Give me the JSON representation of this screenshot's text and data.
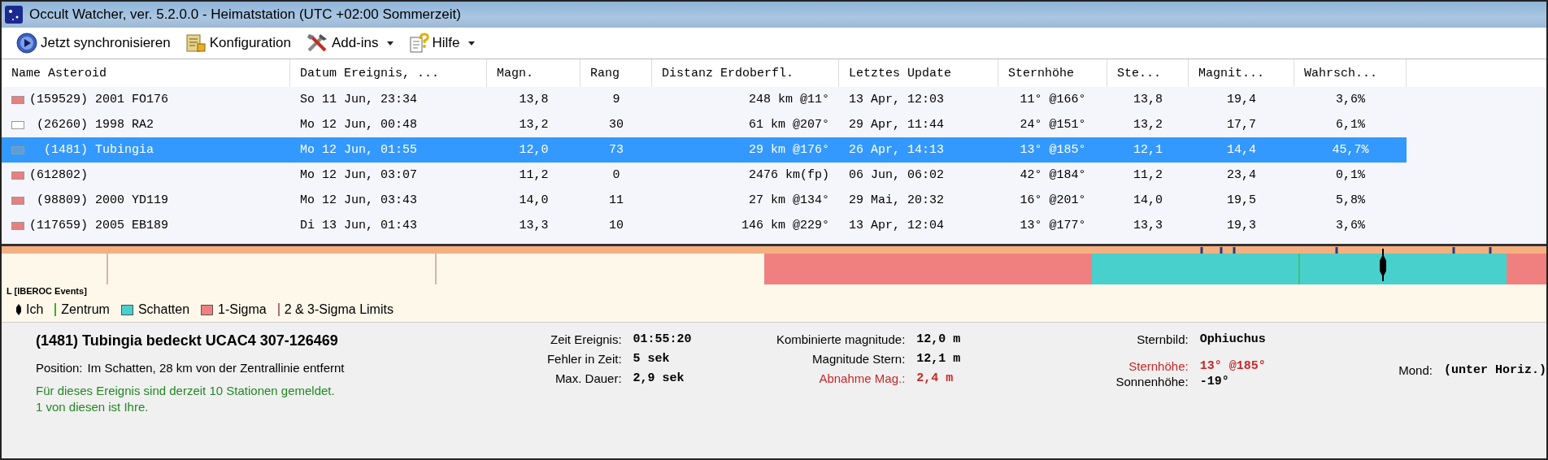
{
  "window": {
    "title": "Occult Watcher, ver. 5.2.0.0 - Heimatstation (UTC +02:00 Sommerzeit)"
  },
  "toolbar": [
    {
      "label": "Jetzt synchronisieren",
      "kind": "sync",
      "dropdown": false
    },
    {
      "label": "Konfiguration",
      "kind": "config",
      "dropdown": false
    },
    {
      "label": "Add-ins",
      "kind": "tools",
      "dropdown": true
    },
    {
      "label": "Hilfe",
      "kind": "help",
      "dropdown": true
    }
  ],
  "table": {
    "columns": [
      "Name Asteroid",
      "Datum Ereignis, ...",
      "Magn.",
      "Rang",
      "Distanz Erdoberfl.",
      "Letztes Update",
      "Sternhöhe",
      "Ste...",
      "Magnit...",
      "Wahrsch..."
    ],
    "rows": [
      {
        "selected": false,
        "color": "#e88080",
        "cells": [
          "(159529) 2001 FO176",
          "So 11 Jun, 23:34",
          "13,8",
          "9",
          "248 km @11°",
          "13 Apr, 12:03",
          "11° @166°",
          "13,8",
          "19,4",
          "3,6%"
        ]
      },
      {
        "selected": false,
        "color": "#ffffff",
        "cells": [
          " (26260) 1998 RA2",
          "Mo 12 Jun, 00:48",
          "13,2",
          "30",
          "61 km @207°",
          "29 Apr, 11:44",
          "24° @151°",
          "13,2",
          "17,7",
          "6,1%"
        ]
      },
      {
        "selected": true,
        "color": "#5aa0d8",
        "cells": [
          "  (1481) Tubingia",
          "Mo 12 Jun, 01:55",
          "12,0",
          "73",
          "29 km @176°",
          "26 Apr, 14:13",
          "13° @185°",
          "12,1",
          "14,4",
          "45,7%"
        ]
      },
      {
        "selected": false,
        "color": "#e88080",
        "cells": [
          "(612802)",
          "Mo 12 Jun, 03:07",
          "11,2",
          "0",
          "2476 km(fp)",
          "06 Jun, 06:02",
          "42° @184°",
          "11,2",
          "23,4",
          "0,1%"
        ]
      },
      {
        "selected": false,
        "color": "#e88080",
        "cells": [
          " (98809) 2000 YD119",
          "Mo 12 Jun, 03:43",
          "14,0",
          "11",
          "27 km @134°",
          "29 Mai, 20:32",
          "16° @201°",
          "14,0",
          "19,5",
          "5,8%"
        ]
      },
      {
        "selected": false,
        "color": "#e88080",
        "cells": [
          "(117659) 2005 EB189",
          "Di 13 Jun, 01:43",
          "13,3",
          "10",
          "146 km @229°",
          "13 Apr, 12:04",
          "13° @177°",
          "13,3",
          "19,3",
          "3,6%"
        ]
      }
    ]
  },
  "strip": {
    "label": "L [IBEROC Events]"
  },
  "legend": [
    {
      "kind": "marker",
      "label": "Ich",
      "color": "#000000"
    },
    {
      "kind": "line",
      "label": "Zentrum",
      "color": "#40b020"
    },
    {
      "kind": "box",
      "label": "Schatten",
      "color": "#48d0cc"
    },
    {
      "kind": "box",
      "label": "1-Sigma",
      "color": "#f08080"
    },
    {
      "kind": "line",
      "label": "2 & 3-Sigma Limits",
      "color": "#b07070"
    }
  ],
  "details": {
    "title": "(1481) Tubingia bedeckt UCAC4 307-126469",
    "position_label": "Position:",
    "position": "Im Schatten, 28 km von der Zentrallinie entfernt",
    "note": [
      "Für dieses Ereignis sind derzeit 10 Stationen gemeldet.",
      "1 von diesen ist Ihre."
    ],
    "columns": [
      [
        {
          "label": "Zeit Ereignis:",
          "value": "01:55:20",
          "alert": false
        },
        {
          "label": "Fehler in Zeit:",
          "value": "5 sek",
          "alert": false
        },
        {
          "label": "Max. Dauer:",
          "value": "2,9 sek",
          "alert": false
        }
      ],
      [
        {
          "label": "Kombinierte magnitude:",
          "value": "12,0 m",
          "alert": false
        },
        {
          "label": "Magnitude Stern:",
          "value": "12,1 m",
          "alert": false
        },
        {
          "label": "Abnahme Mag.:",
          "value": "2,4 m",
          "alert": true
        }
      ],
      [
        {
          "label": "Sternbild:",
          "value": "Ophiuchus",
          "alert": false
        },
        {
          "label": "Sternhöhe:",
          "value": "13° @185°",
          "alert": true
        },
        {
          "label": "Sonnenhöhe:",
          "value": "-19°",
          "alert": false
        }
      ],
      [
        {
          "label": "Mond:",
          "value": "(unter Horiz.)",
          "alert": false
        }
      ]
    ]
  }
}
